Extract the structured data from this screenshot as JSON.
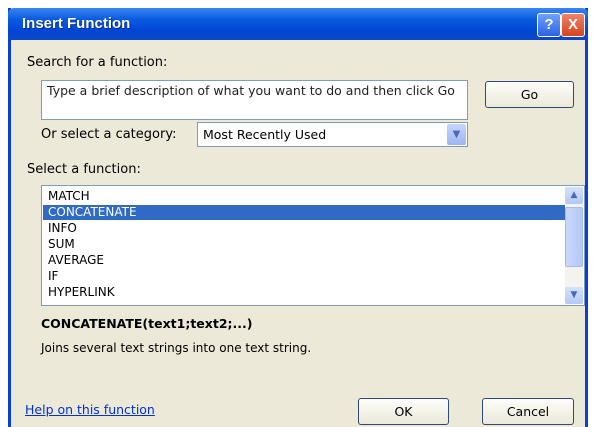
{
  "window": {
    "title": "Insert Function",
    "help_icon": "?",
    "close_icon": "X"
  },
  "search": {
    "label": "Search for a function:",
    "value": "Type a brief description of what you want to do and then click Go",
    "go_label": "Go"
  },
  "category": {
    "label": "Or select a category:",
    "selected": "Most Recently Used"
  },
  "functions": {
    "label": "Select a function:",
    "items": [
      "MATCH",
      "CONCATENATE",
      "INFO",
      "SUM",
      "AVERAGE",
      "IF",
      "HYPERLINK"
    ],
    "selected_index": 1,
    "signature": "CONCATENATE(text1;text2;...)",
    "description": "Joins several text strings into one text string."
  },
  "footer": {
    "help_link": "Help on this function",
    "ok_label": "OK",
    "cancel_label": "Cancel"
  },
  "colors": {
    "title_bar": "#0a5be0",
    "selection": "#316ac5",
    "dialog_bg": "#ece9d8",
    "link": "#0033cc"
  }
}
